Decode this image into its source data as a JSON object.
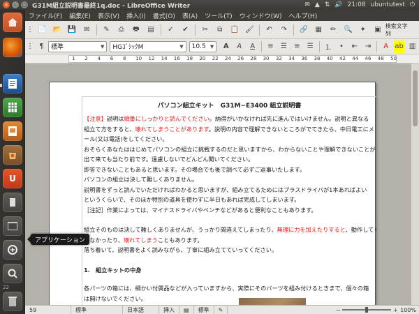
{
  "window": {
    "title": "G31M組立説明書最終1q.doc - LibreOffice Writer",
    "close_glyph": "×",
    "min_glyph": "–",
    "max_glyph": "□"
  },
  "panel": {
    "indicators": [
      "✉",
      "▲",
      "⇅",
      "🔊"
    ],
    "time": "21:08",
    "user": "ubuntutest"
  },
  "menu": [
    "ファイル(F)",
    "編集(E)",
    "表示(V)",
    "挿入(I)",
    "書式(O)",
    "表(A)",
    "ツール(T)",
    "ウィンドウ(W)",
    "ヘルプ(H)"
  ],
  "toolbar": {
    "paragraph_style": "標準",
    "font_name": "HGｺﾞｼｯｸM",
    "font_size": "10.5",
    "search_label": "検索文字列"
  },
  "ruler": {
    "ticks": [
      "1",
      "2",
      "4",
      "6",
      "8",
      "10",
      "12",
      "14",
      "16",
      "18",
      "20",
      "22",
      "24",
      "26",
      "28",
      "30",
      "32",
      "34",
      "36",
      "38",
      "40",
      "42",
      "44",
      "46",
      "48",
      "50"
    ]
  },
  "document": {
    "title": "パソコン組立キット　G31M−E3400 組立説明書",
    "p1_a": "【注意】",
    "p1_b": "説明は",
    "p1_c": "順番にしっかりと読んでください",
    "p1_d": "。納得がいかなければ先に進んではいけません。説明と異なる",
    "p2_a": "組立て方をすると、",
    "p2_b": "壊れてしまうことがあります",
    "p2_c": "。説明の内容で理解できないところがでてきたら、中日電工にメ",
    "p3": "ール(又は電話)をしてください。",
    "p4": "おそらくあなたははじめてパソコンの組立に挑戦するのだと思いますから、わからないことや理解できないことが",
    "p5": "出て来ても当たり前です。遠慮しないでどんどん聞いてください。",
    "p6": "即答できないこともあると思います。その場合でも後で調べて必ずご返事いたします。",
    "p7": "パソコンの組立は決して難しくありません。",
    "p8": "説明書をずっと読んでいただければわかると思いますが、組み立てるためにはプラスドライバが1本あればよい",
    "p9": "というくらいで、そのほか特別の道具を使わずに半日もあれば完成してしまいます。",
    "p10": "［注記］作業によっては、マイナスドライバやペンチなどがあると便利なこともあります。",
    "p11_a": "組立そのものは決して難しくありませんが、うっかり間違えてしまったり、",
    "p11_b": "無理に力を加えたりすると",
    "p11_c": "、動作してく",
    "p12_a": "れなかったり、",
    "p12_b": "壊れてしまう",
    "p12_c": "こともあります。",
    "p13": "落ち着いて、説明書をよく読みながら、丁寧に組み立てていってください。",
    "heading1": "1.　組立キットの中身",
    "p14": "各パーツの箱には、細かい付属品などが入っていますから、実際にそのパーツを組み付けるときまで、個々の箱",
    "p15": "は開けないでください。"
  },
  "statusbar": {
    "page": "59",
    "style": "標準",
    "language": "日本語",
    "insert_mode": "挿入",
    "selection_mode": "標準",
    "zoom": "100%",
    "zoom_level": 0.5
  },
  "tooltip": "アプリケーション",
  "launcher": {
    "items": [
      "dash-home",
      "firefox",
      "writer",
      "calc",
      "impress",
      "software-center",
      "ubuntu-one",
      "workspaces",
      "window-switcher",
      "apps-lens",
      "files-lens",
      "trash"
    ],
    "workspace_label": "22"
  },
  "colors": {
    "accent_red": "#e31b1b",
    "close_orange": "#e6612e",
    "panel_bg": "#3c3b37"
  }
}
